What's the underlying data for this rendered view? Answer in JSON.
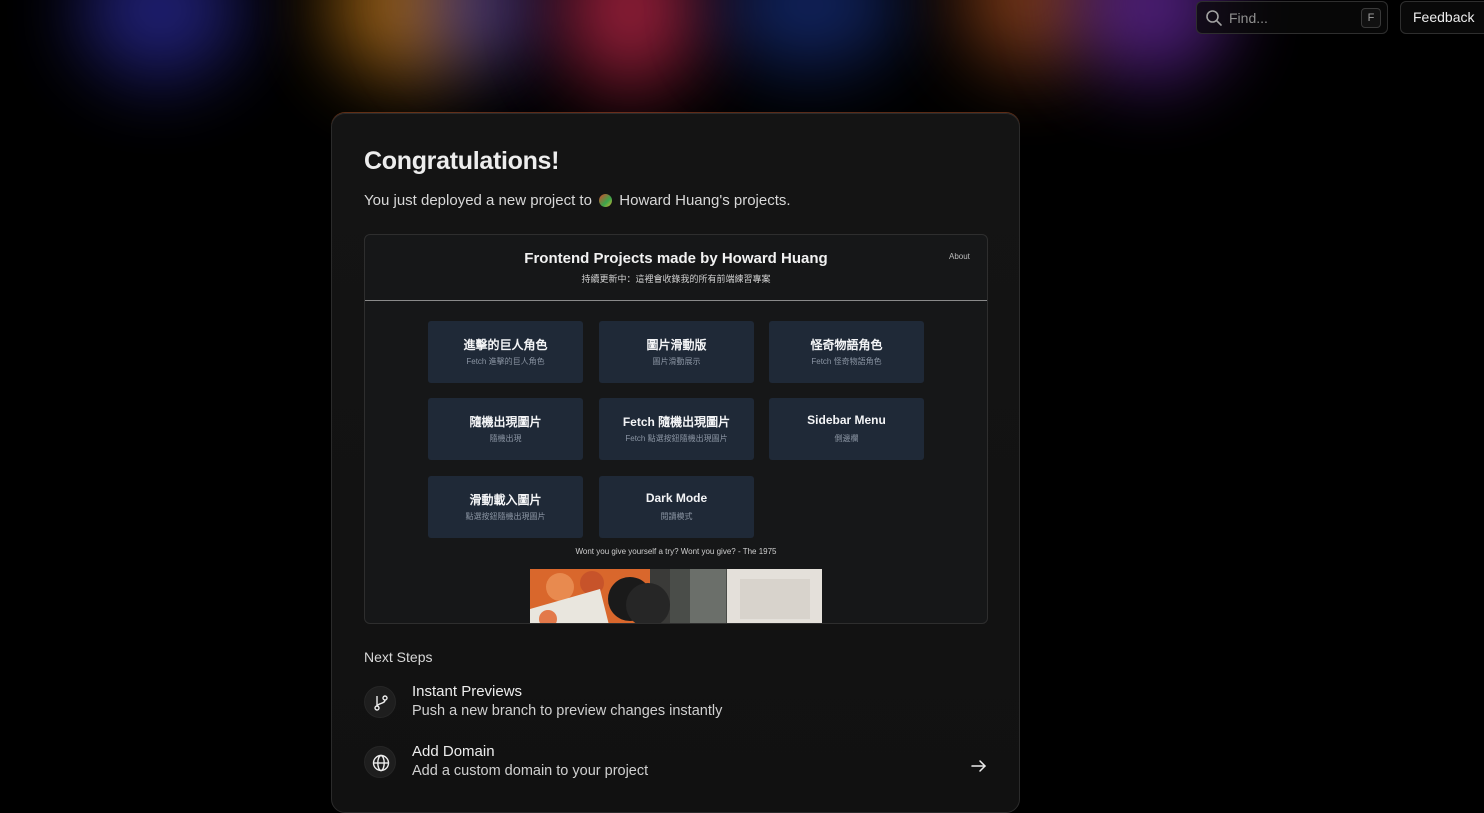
{
  "search": {
    "placeholder": "Find...",
    "shortcut": "F"
  },
  "header": {
    "feedback_label": "Feedback"
  },
  "card": {
    "title": "Congratulations!",
    "subtitle_prefix": "You just deployed a new project to",
    "team_name": "Howard Huang's projects."
  },
  "preview": {
    "site_title": "Frontend Projects made by Howard Huang",
    "site_subtitle": "持續更新中：這裡會收錄我的所有前端練習專案",
    "about_link": "About",
    "tiles": [
      {
        "title": "進擊的巨人角色",
        "desc": "Fetch 進擊的巨人角色"
      },
      {
        "title": "圖片滑動版",
        "desc": "圖片滑動展示"
      },
      {
        "title": "怪奇物語角色",
        "desc": "Fetch 怪奇物語角色"
      },
      {
        "title": "隨機出現圖片",
        "desc": "隨機出現"
      },
      {
        "title": "Fetch 隨機出現圖片",
        "desc": "Fetch 點選按鈕隨機出現圖片"
      },
      {
        "title": "Sidebar Menu",
        "desc": "側邊欄"
      },
      {
        "title": "滑動載入圖片",
        "desc": "點選按鈕隨機出現圖片"
      },
      {
        "title": "Dark Mode",
        "desc": "閱讀模式"
      }
    ],
    "quote": "Wont you give yourself a try? Wont you give? - The 1975"
  },
  "next_steps": {
    "heading": "Next Steps",
    "items": [
      {
        "title": "Instant Previews",
        "desc": "Push a new branch to preview changes instantly",
        "icon": "git-branch-icon"
      },
      {
        "title": "Add Domain",
        "desc": "Add a custom domain to your project",
        "icon": "globe-icon"
      }
    ]
  },
  "colors": {
    "background": "#000000",
    "card": "#131313",
    "tile": "#1f2937",
    "accent_glow": "#ff5a2a"
  }
}
